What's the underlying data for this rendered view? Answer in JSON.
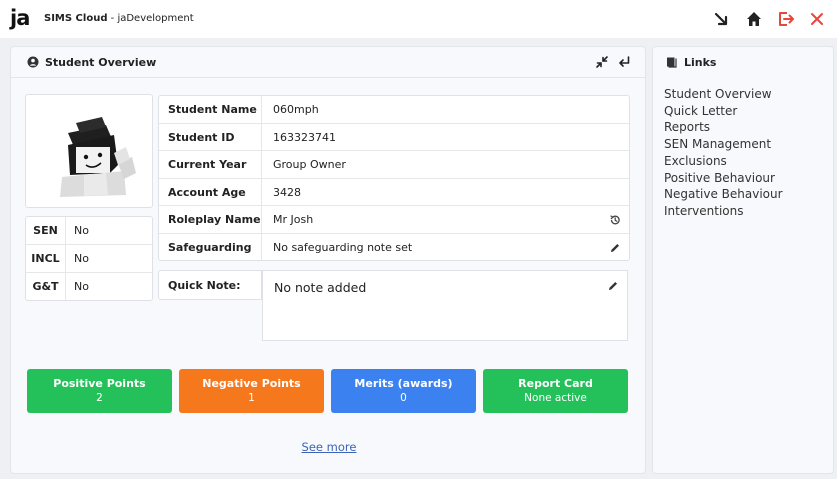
{
  "app": {
    "logo": "ja",
    "title_bold": "SIMS Cloud",
    "title_rest": " - jaDevelopment"
  },
  "overview": {
    "title": "Student Overview"
  },
  "flags": [
    {
      "label": "SEN",
      "value": "No"
    },
    {
      "label": "INCL",
      "value": "No"
    },
    {
      "label": "G&T",
      "value": "No"
    }
  ],
  "info": [
    {
      "label": "Student Name",
      "value": "060mph"
    },
    {
      "label": "Student ID",
      "value": "163323741"
    },
    {
      "label": "Current Year",
      "value": "Group Owner"
    },
    {
      "label": "Account Age",
      "value": "3428"
    },
    {
      "label": "Roleplay Name",
      "value": "Mr Josh"
    },
    {
      "label": "Safeguarding",
      "value": "No safeguarding note set"
    }
  ],
  "quick_note": {
    "label": "Quick Note:",
    "value": "No note added"
  },
  "stats": [
    {
      "label": "Positive Points",
      "value": "2",
      "color": "#24c05a"
    },
    {
      "label": "Negative Points",
      "value": "1",
      "color": "#f6781d"
    },
    {
      "label": "Merits (awards)",
      "value": "0",
      "color": "#3b82f0"
    },
    {
      "label": "Report Card",
      "value": "None active",
      "color": "#24c05a"
    }
  ],
  "see_more": "See more",
  "links": {
    "title": "Links",
    "items": [
      "Student Overview",
      "Quick Letter",
      "Reports",
      "SEN Management",
      "Exclusions",
      "Positive Behaviour",
      "Negative Behaviour",
      "Interventions"
    ]
  },
  "colors": {
    "close_red": "#e8453c"
  }
}
